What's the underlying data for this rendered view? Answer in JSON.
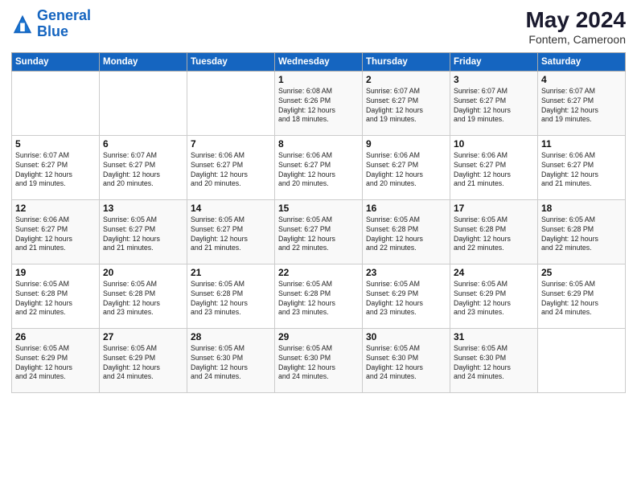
{
  "logo": {
    "line1": "General",
    "line2": "Blue"
  },
  "header": {
    "month": "May 2024",
    "location": "Fontem, Cameroon"
  },
  "weekdays": [
    "Sunday",
    "Monday",
    "Tuesday",
    "Wednesday",
    "Thursday",
    "Friday",
    "Saturday"
  ],
  "weeks": [
    [
      {
        "day": "",
        "text": ""
      },
      {
        "day": "",
        "text": ""
      },
      {
        "day": "",
        "text": ""
      },
      {
        "day": "1",
        "text": "Sunrise: 6:08 AM\nSunset: 6:26 PM\nDaylight: 12 hours\nand 18 minutes."
      },
      {
        "day": "2",
        "text": "Sunrise: 6:07 AM\nSunset: 6:27 PM\nDaylight: 12 hours\nand 19 minutes."
      },
      {
        "day": "3",
        "text": "Sunrise: 6:07 AM\nSunset: 6:27 PM\nDaylight: 12 hours\nand 19 minutes."
      },
      {
        "day": "4",
        "text": "Sunrise: 6:07 AM\nSunset: 6:27 PM\nDaylight: 12 hours\nand 19 minutes."
      }
    ],
    [
      {
        "day": "5",
        "text": "Sunrise: 6:07 AM\nSunset: 6:27 PM\nDaylight: 12 hours\nand 19 minutes."
      },
      {
        "day": "6",
        "text": "Sunrise: 6:07 AM\nSunset: 6:27 PM\nDaylight: 12 hours\nand 20 minutes."
      },
      {
        "day": "7",
        "text": "Sunrise: 6:06 AM\nSunset: 6:27 PM\nDaylight: 12 hours\nand 20 minutes."
      },
      {
        "day": "8",
        "text": "Sunrise: 6:06 AM\nSunset: 6:27 PM\nDaylight: 12 hours\nand 20 minutes."
      },
      {
        "day": "9",
        "text": "Sunrise: 6:06 AM\nSunset: 6:27 PM\nDaylight: 12 hours\nand 20 minutes."
      },
      {
        "day": "10",
        "text": "Sunrise: 6:06 AM\nSunset: 6:27 PM\nDaylight: 12 hours\nand 21 minutes."
      },
      {
        "day": "11",
        "text": "Sunrise: 6:06 AM\nSunset: 6:27 PM\nDaylight: 12 hours\nand 21 minutes."
      }
    ],
    [
      {
        "day": "12",
        "text": "Sunrise: 6:06 AM\nSunset: 6:27 PM\nDaylight: 12 hours\nand 21 minutes."
      },
      {
        "day": "13",
        "text": "Sunrise: 6:05 AM\nSunset: 6:27 PM\nDaylight: 12 hours\nand 21 minutes."
      },
      {
        "day": "14",
        "text": "Sunrise: 6:05 AM\nSunset: 6:27 PM\nDaylight: 12 hours\nand 21 minutes."
      },
      {
        "day": "15",
        "text": "Sunrise: 6:05 AM\nSunset: 6:27 PM\nDaylight: 12 hours\nand 22 minutes."
      },
      {
        "day": "16",
        "text": "Sunrise: 6:05 AM\nSunset: 6:28 PM\nDaylight: 12 hours\nand 22 minutes."
      },
      {
        "day": "17",
        "text": "Sunrise: 6:05 AM\nSunset: 6:28 PM\nDaylight: 12 hours\nand 22 minutes."
      },
      {
        "day": "18",
        "text": "Sunrise: 6:05 AM\nSunset: 6:28 PM\nDaylight: 12 hours\nand 22 minutes."
      }
    ],
    [
      {
        "day": "19",
        "text": "Sunrise: 6:05 AM\nSunset: 6:28 PM\nDaylight: 12 hours\nand 22 minutes."
      },
      {
        "day": "20",
        "text": "Sunrise: 6:05 AM\nSunset: 6:28 PM\nDaylight: 12 hours\nand 23 minutes."
      },
      {
        "day": "21",
        "text": "Sunrise: 6:05 AM\nSunset: 6:28 PM\nDaylight: 12 hours\nand 23 minutes."
      },
      {
        "day": "22",
        "text": "Sunrise: 6:05 AM\nSunset: 6:28 PM\nDaylight: 12 hours\nand 23 minutes."
      },
      {
        "day": "23",
        "text": "Sunrise: 6:05 AM\nSunset: 6:29 PM\nDaylight: 12 hours\nand 23 minutes."
      },
      {
        "day": "24",
        "text": "Sunrise: 6:05 AM\nSunset: 6:29 PM\nDaylight: 12 hours\nand 23 minutes."
      },
      {
        "day": "25",
        "text": "Sunrise: 6:05 AM\nSunset: 6:29 PM\nDaylight: 12 hours\nand 24 minutes."
      }
    ],
    [
      {
        "day": "26",
        "text": "Sunrise: 6:05 AM\nSunset: 6:29 PM\nDaylight: 12 hours\nand 24 minutes."
      },
      {
        "day": "27",
        "text": "Sunrise: 6:05 AM\nSunset: 6:29 PM\nDaylight: 12 hours\nand 24 minutes."
      },
      {
        "day": "28",
        "text": "Sunrise: 6:05 AM\nSunset: 6:30 PM\nDaylight: 12 hours\nand 24 minutes."
      },
      {
        "day": "29",
        "text": "Sunrise: 6:05 AM\nSunset: 6:30 PM\nDaylight: 12 hours\nand 24 minutes."
      },
      {
        "day": "30",
        "text": "Sunrise: 6:05 AM\nSunset: 6:30 PM\nDaylight: 12 hours\nand 24 minutes."
      },
      {
        "day": "31",
        "text": "Sunrise: 6:05 AM\nSunset: 6:30 PM\nDaylight: 12 hours\nand 24 minutes."
      },
      {
        "day": "",
        "text": ""
      }
    ]
  ]
}
